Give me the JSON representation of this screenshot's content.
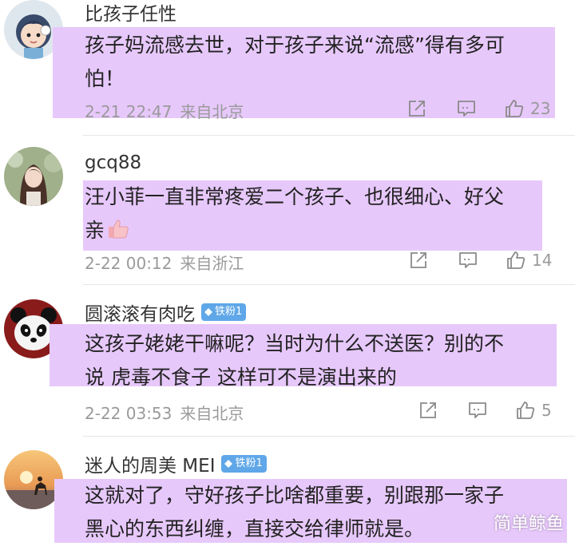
{
  "comments": [
    {
      "username": "比孩子任性",
      "badge": null,
      "lines": [
        "孩子妈流感去世，对于孩子来说“流感”得有多可",
        "怕！"
      ],
      "time": "2-21 22:47",
      "from": "来自北京",
      "likes": "23"
    },
    {
      "username": "gcq88",
      "badge": null,
      "lines": [
        "汪小菲一直非常疼爱二个孩子、也很细心、好父",
        "亲"
      ],
      "emoji": "thumbs-up-emoji",
      "time": "2-22 00:12",
      "from": "来自浙江",
      "likes": "14"
    },
    {
      "username": "圆滚滚有肉吃",
      "badge": "铁粉1",
      "lines": [
        "这孩子姥姥干嘛呢？当时为什么不送医？别的不",
        "说 虎毒不食子 这样可不是演出来的"
      ],
      "time": "2-22 03:53",
      "from": "来自北京",
      "likes": "5"
    },
    {
      "username": "迷人的周美 MEI",
      "badge": "铁粉1",
      "lines": [
        "这就对了，守好孩子比啥都重要，别跟那一家子",
        "黑心的东西纠缠，直接交给律师就是。"
      ]
    }
  ],
  "icons": {
    "share": "share-icon",
    "comment": "comment-icon",
    "like": "like-icon",
    "badge": "diamond-icon"
  },
  "colors": {
    "highlight": "#e7c8fb",
    "badge_bg": "#5fa7e8",
    "meta_text": "#9a9a9a"
  },
  "watermark": "简单鲸鱼"
}
